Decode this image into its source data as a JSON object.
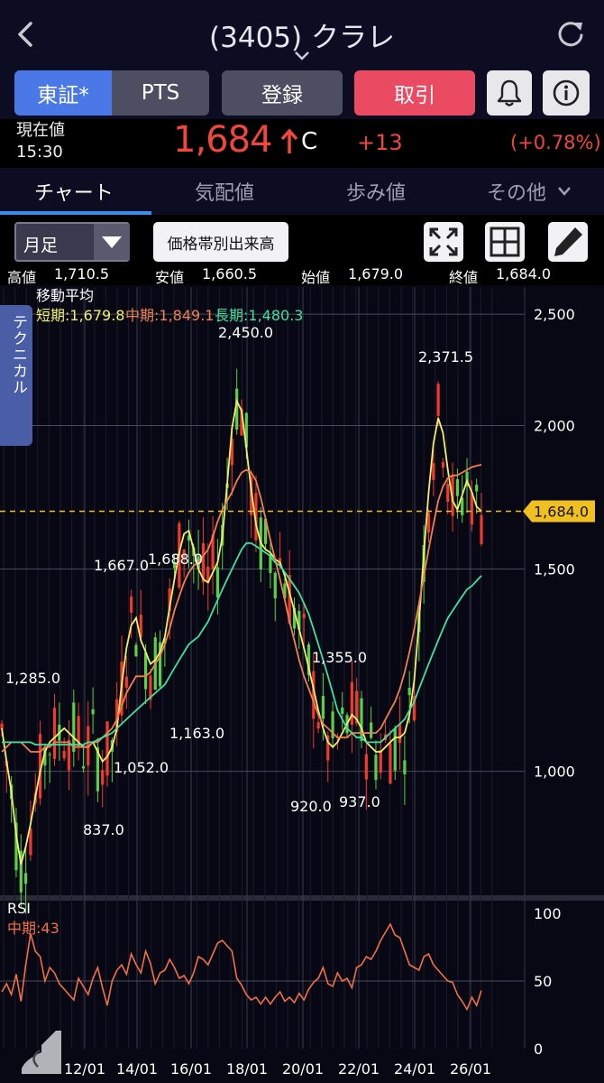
{
  "header": {
    "title": "(3405) クラレ",
    "icons": {
      "back": "chevron-left-icon",
      "refresh": "refresh-icon",
      "title_dropdown": "chevron-down-icon"
    }
  },
  "buttons": {
    "tosho": "東証*",
    "pts": "PTS",
    "register": "登録",
    "trade": "取引",
    "bell_icon": "bell-icon",
    "info_icon": "info-icon"
  },
  "price": {
    "label": "現在値",
    "time": "15:30",
    "value": "1,684",
    "flag": "C",
    "change": "+13",
    "change_pct": "(+0.78%)",
    "up_color": "#f0463e"
  },
  "tabs": {
    "chart": "チャート",
    "quote": "気配値",
    "ticks": "歩み値",
    "more": "その他"
  },
  "controls": {
    "period": "月足",
    "volume_by_price": "価格帯別出来高",
    "expand_icon": "expand-icon",
    "layout_icon": "grid-icon",
    "draw_icon": "pencil-icon"
  },
  "ohlc": {
    "high_label": "高値",
    "high": "1,710.5",
    "low_label": "安値",
    "low": "1,660.5",
    "open_label": "始値",
    "open": "1,679.0",
    "close_label": "終値",
    "close": "1,684.0"
  },
  "side_tab": "テクニカル",
  "chart_data": [
    {
      "type": "candlestick",
      "panel": "price",
      "title": "移動平均",
      "x_ticks": [
        "12/01",
        "14/01",
        "16/01",
        "18/01",
        "20/01",
        "22/01",
        "24/01",
        "26/01"
      ],
      "y_ticks": [
        1000,
        1500,
        2000,
        2500
      ],
      "y_tick_labels": [
        "1,000",
        "1,500",
        "2,000",
        "2,500"
      ],
      "y_scale": "log",
      "ylim": [
        780,
        2640
      ],
      "grid": true,
      "current_price": 1684.0,
      "current_price_label": "1,684.0",
      "series": [
        {
          "name": "短期",
          "label": "短期:1,679.8",
          "color": "#f0f06a",
          "values": [
            1090,
            1020,
            960,
            880,
            830,
            860,
            900,
            950,
            1000,
            1040,
            1060,
            1070,
            1080,
            1090,
            1080,
            1070,
            1060,
            1050,
            1050,
            1060,
            1040,
            1020,
            1030,
            1050,
            1090,
            1190,
            1280,
            1340,
            1360,
            1300,
            1270,
            1240,
            1250,
            1270,
            1310,
            1390,
            1470,
            1550,
            1610,
            1620,
            1560,
            1500,
            1470,
            1460,
            1490,
            1520,
            1600,
            1780,
            1990,
            2100,
            2060,
            1910,
            1760,
            1640,
            1580,
            1560,
            1550,
            1530,
            1520,
            1480,
            1430,
            1380,
            1330,
            1280,
            1230,
            1180,
            1130,
            1090,
            1060,
            1050,
            1060,
            1080,
            1100,
            1120,
            1110,
            1090,
            1060,
            1050,
            1040,
            1040,
            1050,
            1060,
            1070,
            1070,
            1080,
            1120,
            1200,
            1350,
            1550,
            1750,
            1930,
            2030,
            1970,
            1830,
            1720,
            1690,
            1740,
            1790,
            1750,
            1700,
            1684
          ]
        },
        {
          "name": "中期",
          "label": "中期:1,849.1",
          "color": "#f08050",
          "values": [
            1040,
            1050,
            1060,
            1060,
            1060,
            1050,
            1040,
            1040,
            1040,
            1050,
            1050,
            1060,
            1060,
            1060,
            1060,
            1050,
            1050,
            1050,
            1050,
            1060,
            1060,
            1070,
            1080,
            1090,
            1110,
            1140,
            1170,
            1190,
            1210,
            1210,
            1210,
            1220,
            1240,
            1260,
            1290,
            1330,
            1380,
            1420,
            1460,
            1490,
            1510,
            1520,
            1540,
            1560,
            1600,
            1650,
            1690,
            1720,
            1750,
            1790,
            1820,
            1830,
            1820,
            1790,
            1730,
            1660,
            1590,
            1530,
            1470,
            1410,
            1350,
            1300,
            1250,
            1210,
            1180,
            1150,
            1120,
            1100,
            1090,
            1080,
            1070,
            1070,
            1070,
            1080,
            1080,
            1080,
            1080,
            1080,
            1080,
            1090,
            1110,
            1130,
            1150,
            1180,
            1220,
            1270,
            1330,
            1400,
            1480,
            1560,
            1640,
            1720,
            1770,
            1800,
            1810,
            1810,
            1820,
            1830,
            1840,
            1845,
            1849
          ]
        },
        {
          "name": "長期",
          "label": "長期:1,480.3",
          "color": "#40e0a0",
          "values": [
            1060,
            1060,
            1060,
            1060,
            1060,
            1060,
            1060,
            1055,
            1055,
            1055,
            1055,
            1055,
            1055,
            1055,
            1055,
            1055,
            1055,
            1055,
            1060,
            1060,
            1065,
            1070,
            1075,
            1080,
            1090,
            1100,
            1110,
            1120,
            1130,
            1140,
            1150,
            1160,
            1170,
            1180,
            1190,
            1210,
            1230,
            1250,
            1270,
            1290,
            1300,
            1310,
            1330,
            1350,
            1380,
            1410,
            1440,
            1470,
            1500,
            1530,
            1560,
            1580,
            1580,
            1570,
            1560,
            1550,
            1540,
            1520,
            1510,
            1490,
            1470,
            1450,
            1430,
            1400,
            1370,
            1330,
            1290,
            1250,
            1210,
            1170,
            1130,
            1110,
            1090,
            1080,
            1070,
            1070,
            1060,
            1060,
            1060,
            1060,
            1070,
            1080,
            1090,
            1100,
            1110,
            1130,
            1150,
            1180,
            1210,
            1240,
            1270,
            1300,
            1330,
            1360,
            1380,
            1400,
            1420,
            1440,
            1450,
            1465,
            1480
          ]
        }
      ],
      "annotations": [
        {
          "label": "1,285.0",
          "value": 1285.0
        },
        {
          "label": "837.0",
          "value": 837.0
        },
        {
          "label": "1,052.0",
          "value": 1052.0
        },
        {
          "label": "1,667.0",
          "value": 1667.0
        },
        {
          "label": "1,688.0",
          "value": 1688.0
        },
        {
          "label": "1,163.0",
          "value": 1163.0
        },
        {
          "label": "2,450.0",
          "value": 2450.0
        },
        {
          "label": "1,355.0",
          "value": 1355.0
        },
        {
          "label": "920.0",
          "value": 920.0
        },
        {
          "label": "937.0",
          "value": 937.0
        },
        {
          "label": "2,371.5",
          "value": 2371.5
        }
      ],
      "up_color": "#f03a2e",
      "down_color": "#5ad04a"
    },
    {
      "type": "line",
      "panel": "rsi",
      "title": "RSI",
      "series": [
        {
          "name": "中期",
          "label": "中期:43",
          "color": "#f07048",
          "values": [
            42,
            48,
            40,
            55,
            35,
            62,
            85,
            72,
            68,
            50,
            60,
            56,
            48,
            44,
            40,
            36,
            52,
            46,
            40,
            52,
            60,
            45,
            32,
            50,
            58,
            62,
            55,
            70,
            62,
            56,
            72,
            63,
            48,
            56,
            58,
            66,
            60,
            52,
            54,
            48,
            56,
            68,
            66,
            62,
            70,
            78,
            80,
            76,
            72,
            52,
            47,
            40,
            36,
            38,
            33,
            38,
            33,
            38,
            42,
            35,
            38,
            34,
            41,
            36,
            44,
            49,
            52,
            60,
            48,
            46,
            56,
            50,
            52,
            45,
            60,
            62,
            68,
            66,
            72,
            80,
            86,
            92,
            84,
            82,
            72,
            62,
            60,
            58,
            68,
            70,
            62,
            58,
            54,
            50,
            49,
            40,
            35,
            29,
            38,
            32,
            43
          ]
        }
      ],
      "y_ticks": [
        0,
        50,
        100
      ],
      "ylim": [
        0,
        100
      ],
      "grid": true
    }
  ]
}
